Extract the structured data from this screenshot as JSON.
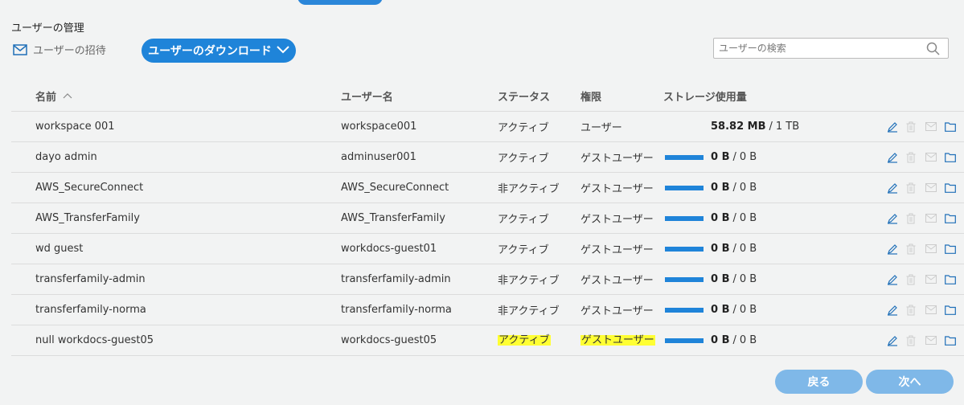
{
  "page": {
    "title": "ユーザーの管理",
    "invite_label": "ユーザーの招待",
    "download_label": "ユーザーのダウンロード",
    "search_placeholder": "ユーザーの検索"
  },
  "table": {
    "headers": {
      "name": "名前",
      "username": "ユーザー名",
      "status": "ステータス",
      "role": "権限",
      "storage": "ストレージ使用量"
    },
    "rows": [
      {
        "name": "workspace 001",
        "username": "workspace001",
        "status": "アクティブ",
        "role": "ユーザー",
        "used": "58.82 MB",
        "total": "1 TB",
        "bar": false,
        "highlight": false
      },
      {
        "name": "dayo admin",
        "username": "adminuser001",
        "status": "アクティブ",
        "role": "ゲストユーザー",
        "used": "0 B",
        "total": "0 B",
        "bar": true,
        "highlight": false
      },
      {
        "name": "AWS_SecureConnect",
        "username": "AWS_SecureConnect",
        "status": "非アクティブ",
        "role": "ゲストユーザー",
        "used": "0 B",
        "total": "0 B",
        "bar": true,
        "highlight": false
      },
      {
        "name": "AWS_TransferFamily",
        "username": "AWS_TransferFamily",
        "status": "アクティブ",
        "role": "ゲストユーザー",
        "used": "0 B",
        "total": "0 B",
        "bar": true,
        "highlight": false
      },
      {
        "name": "wd guest",
        "username": "workdocs-guest01",
        "status": "アクティブ",
        "role": "ゲストユーザー",
        "used": "0 B",
        "total": "0 B",
        "bar": true,
        "highlight": false
      },
      {
        "name": "transferfamily-admin",
        "username": "transferfamily-admin",
        "status": "非アクティブ",
        "role": "ゲストユーザー",
        "used": "0 B",
        "total": "0 B",
        "bar": true,
        "highlight": false
      },
      {
        "name": "transferfamily-norma",
        "username": "transferfamily-norma",
        "status": "非アクティブ",
        "role": "ゲストユーザー",
        "used": "0 B",
        "total": "0 B",
        "bar": true,
        "highlight": false
      },
      {
        "name": "null workdocs-guest05",
        "username": "workdocs-guest05",
        "status": "アクティブ",
        "role": "ゲストユーザー",
        "used": "0 B",
        "total": "0 B",
        "bar": true,
        "highlight": true
      }
    ],
    "storage_separator": "/"
  },
  "footer": {
    "back_label": "戻る",
    "next_label": "次へ"
  },
  "icons": [
    "mail-icon",
    "chevron-down-icon",
    "search-icon",
    "sort-ascending-icon",
    "edit-icon",
    "trash-icon",
    "mail-icon",
    "folder-icon"
  ],
  "colors": {
    "accent": "#1f84d9",
    "disabled_button": "#7fb8e8",
    "highlight": "#ffff33"
  }
}
